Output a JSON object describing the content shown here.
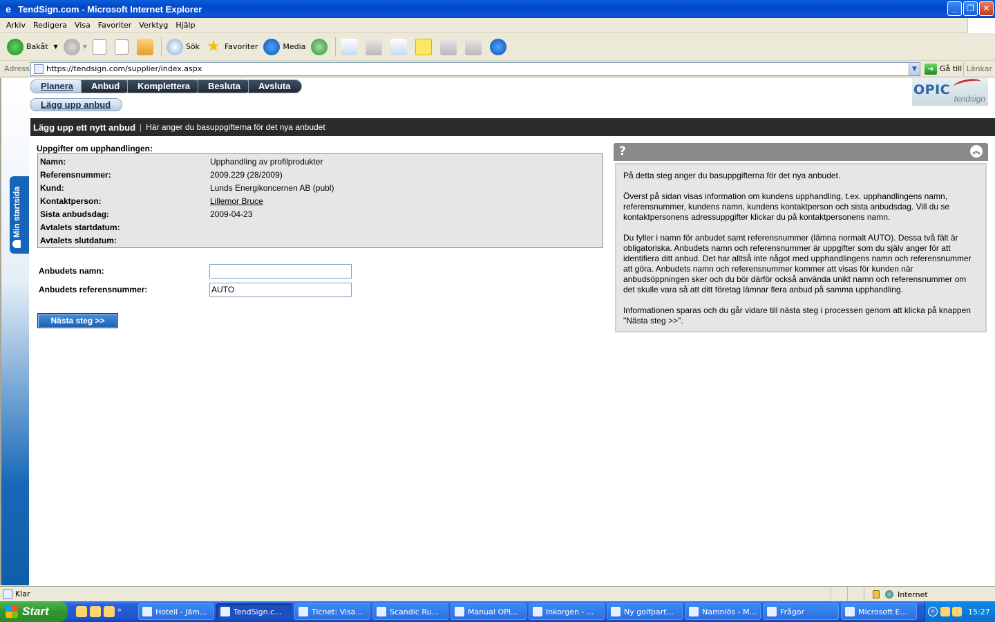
{
  "window": {
    "title": "TendSign.com - Microsoft Internet Explorer",
    "controls": {
      "minimize": "_",
      "maximize": "❐",
      "close": "✕"
    }
  },
  "menu": [
    "Arkiv",
    "Redigera",
    "Visa",
    "Favoriter",
    "Verktyg",
    "Hjälp"
  ],
  "toolbar": {
    "back": "Bakåt",
    "search": "Sök",
    "favorites": "Favoriter",
    "media": "Media"
  },
  "address": {
    "label": "Adress",
    "url": "https://tendsign.com/supplier/index.aspx",
    "go": "Gå till",
    "links": "Länkar"
  },
  "sidebar": {
    "label": "Min startsida"
  },
  "steps": [
    "Planera",
    "Anbud",
    "Komplettera",
    "Besluta",
    "Avsluta"
  ],
  "substep": "Lägg upp anbud",
  "logo": {
    "main": "OPIC",
    "sub": "tendsign"
  },
  "header": {
    "title": "Lägg upp ett nytt anbud",
    "separator": "|",
    "subtitle": "Här anger du basuppgifterna för det nya anbudet"
  },
  "procurement": {
    "section_title": "Uppgifter om upphandlingen:",
    "rows": [
      {
        "label": "Namn:",
        "value": "Upphandling av profilprodukter"
      },
      {
        "label": "Referensnummer:",
        "value": "2009.229 (28/2009)"
      },
      {
        "label": "Kund:",
        "value": "Lunds Energikoncernen AB (publ)"
      },
      {
        "label": "Kontaktperson:",
        "value": "Lillemor Bruce"
      },
      {
        "label": "Sista anbudsdag:",
        "value": "2009-04-23"
      },
      {
        "label": "Avtalets startdatum:",
        "value": ""
      },
      {
        "label": "Avtalets slutdatum:",
        "value": ""
      }
    ]
  },
  "form": {
    "name_label": "Anbudets namn:",
    "name_value": "",
    "ref_label": "Anbudets referensnummer:",
    "ref_value": "AUTO",
    "next_button": "Nästa steg >>"
  },
  "help": {
    "icon": "?",
    "collapse": "︽",
    "paragraphs": [
      "På detta steg anger du basuppgifterna för det nya anbudet.",
      "Överst på sidan visas information om kundens upphandling, t.ex. upphandlingens namn, referensnummer, kundens namn, kundens kontaktperson och sista anbudsdag. Vill du se kontaktpersonens adressuppgifter klickar du på kontaktpersonens namn.",
      "Du fyller i namn för anbudet samt referensnummer (lämna normalt AUTO). Dessa två fält är obligatoriska. Anbudets namn och referensnummer är uppgifter som du själv anger för att identifiera ditt anbud. Det har alltså inte något med upphandlingens namn och referensnummer att göra. Anbudets namn och referensnummer kommer att visas för kunden när anbudsöppningen sker och du bör därför också använda unikt namn och referensnummer om det skulle vara så att ditt företag lämnar flera anbud på samma upphandling.",
      "Informationen sparas och du går vidare till nästa steg i processen genom att klicka på knappen \"Nästa steg >>\"."
    ]
  },
  "status": {
    "text": "Klar",
    "zone": "Internet"
  },
  "taskbar": {
    "start": "Start",
    "more": "»",
    "tasks": [
      "Hotell - Jäm...",
      "TendSign.c...",
      "Ticnet: Visa...",
      "Scandic Ru...",
      "Manual OPI...",
      "Inkorgen - ...",
      "Ny golfpart...",
      "Namnlös - M...",
      "Frågor",
      "Microsoft E..."
    ],
    "active_index": 1,
    "tray_arrow": "<",
    "clock": "15:27"
  }
}
